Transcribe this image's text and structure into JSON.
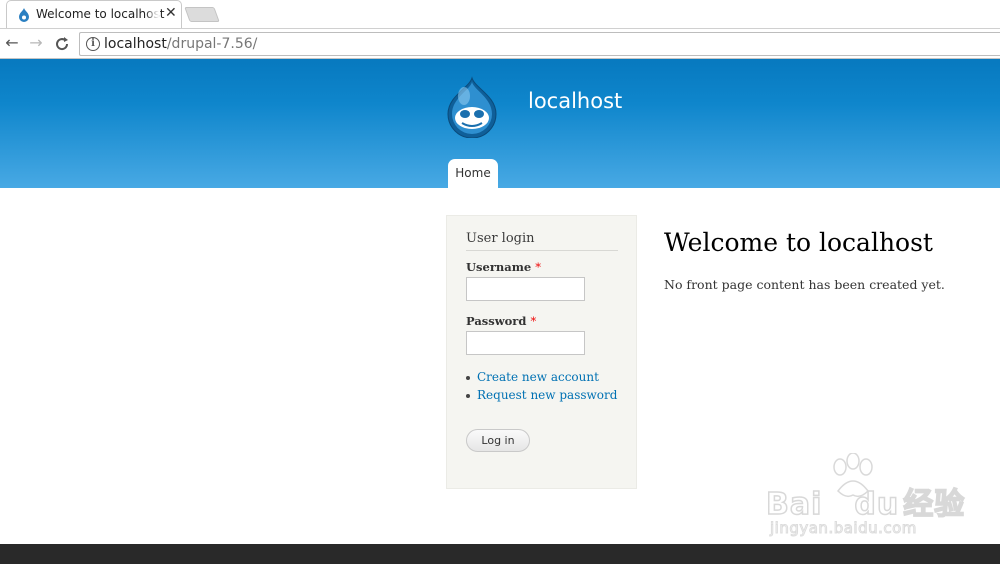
{
  "browser": {
    "tab_title": "Welcome to localhost",
    "tab_close": "✕",
    "url_host": "localhost",
    "url_path": "/drupal-7.56/",
    "back": "←",
    "forward": "→",
    "reload": "C"
  },
  "header": {
    "site_name": "localhost",
    "menu": [
      {
        "label": "Home"
      }
    ]
  },
  "login_block": {
    "title": "User login",
    "username_label": "Username",
    "password_label": "Password",
    "required_marker": "*",
    "username_value": "",
    "password_value": "",
    "links": [
      {
        "label": "Create new account"
      },
      {
        "label": "Request new password"
      }
    ],
    "submit_label": "Log in"
  },
  "main": {
    "title": "Welcome to localhost",
    "text": "No front page content has been created yet."
  },
  "watermark": {
    "brand_a": "Bai",
    "brand_b": "du",
    "brand_cn": "经验",
    "subtitle": "jingyan.baidu.com"
  },
  "colors": {
    "header_top": "#0779bf",
    "header_bottom": "#48a9e4",
    "link": "#0071b3",
    "footer": "#292929"
  },
  "icons": {
    "favicon": "drupal-drop-icon",
    "logo": "drupal-logo-icon",
    "info": "info-icon"
  }
}
